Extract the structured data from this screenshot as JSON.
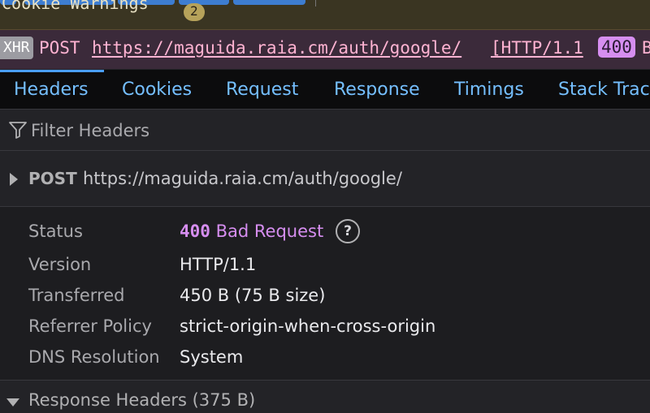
{
  "top": {
    "warning_text": "Cookie Warnings",
    "warning_count": "2"
  },
  "request": {
    "badge": "XHR",
    "method": "POST",
    "url": "https://maguida.raia.cm/auth/google/",
    "protocol": "[HTTP/1.1",
    "status": "400",
    "trail": "B"
  },
  "tabs": [
    {
      "label": "Headers"
    },
    {
      "label": "Cookies"
    },
    {
      "label": "Request"
    },
    {
      "label": "Response"
    },
    {
      "label": "Timings"
    },
    {
      "label": "Stack Trace"
    }
  ],
  "filter": {
    "placeholder": "Filter Headers"
  },
  "summary": {
    "method": "POST",
    "url": "https://maguida.raia.cm/auth/google/"
  },
  "details": {
    "status_label": "Status",
    "status_code": "400",
    "status_text": "Bad Request",
    "help_glyph": "?",
    "version_label": "Version",
    "version_value": "HTTP/1.1",
    "transferred_label": "Transferred",
    "transferred_value": "450 B (75 B size)",
    "referrer_label": "Referrer Policy",
    "referrer_value": "strict-origin-when-cross-origin",
    "dns_label": "DNS Resolution",
    "dns_value": "System"
  },
  "response_headers": {
    "label": "Response Headers (375 B)"
  },
  "colors": {
    "accent": "#75bfff",
    "status_error": "#d68ef0",
    "row_highlight": "#3b2a3a"
  }
}
